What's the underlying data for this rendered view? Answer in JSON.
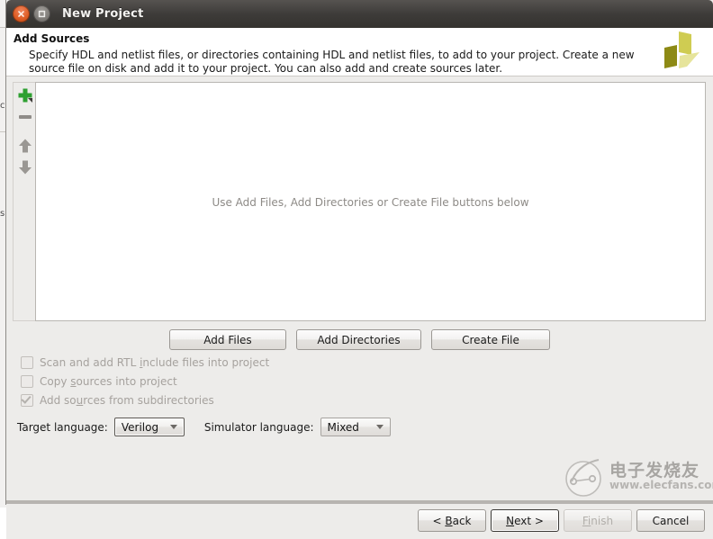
{
  "background_window": {
    "glyphs": [
      "c",
      "s"
    ]
  },
  "titlebar": {
    "title": "New Project",
    "close_icon": "close-icon",
    "maximize_icon": "maximize-icon"
  },
  "header": {
    "title": "Add Sources",
    "description": "Specify HDL and netlist files, or directories containing HDL and netlist files, to add to your project. Create a new source file on disk and add it to your project. You can also add and create sources later.",
    "logo": "xilinx-logo",
    "logo_colors": [
      "#cfcc52",
      "#8d8a15",
      "#e6e49b"
    ]
  },
  "side_toolbar": {
    "add_label": "add-icon",
    "remove_label": "remove-icon",
    "move_up_label": "move-up-icon",
    "move_down_label": "move-down-icon",
    "add_color": "#2ea031",
    "arrow_color": "#8f8c88"
  },
  "source_list": {
    "placeholder": "Use Add Files, Add Directories or Create File buttons below"
  },
  "action_buttons": {
    "add_files": "Add Files",
    "add_directories": "Add Directories",
    "create_file": "Create File"
  },
  "options": [
    {
      "id": "scan-rtl-include",
      "label_before": "Scan and add RTL ",
      "mnemonic": "i",
      "label_after": "nclude files into project",
      "checked": false,
      "enabled": false
    },
    {
      "id": "copy-sources",
      "label_before": "Copy ",
      "mnemonic": "s",
      "label_after": "ources into project",
      "checked": false,
      "enabled": false
    },
    {
      "id": "add-subdirectories",
      "label_before": "Add so",
      "mnemonic": "u",
      "label_after": "rces from subdirectories",
      "checked": true,
      "enabled": false
    }
  ],
  "language_row": {
    "target_label": "Target language:",
    "target_value": "Verilog",
    "simulator_label": "Simulator language:",
    "simulator_value": "Mixed"
  },
  "footer": {
    "back_before": "< ",
    "back_mnemonic": "B",
    "back_after": "ack",
    "next_before": "",
    "next_mnemonic": "N",
    "next_after": "ext >",
    "finish_before": "",
    "finish_mnemonic": "Fi",
    "finish_after": "nish",
    "cancel": "Cancel"
  },
  "watermark": {
    "chinese": "电子发烧友",
    "url": "www.elecfans.com"
  }
}
